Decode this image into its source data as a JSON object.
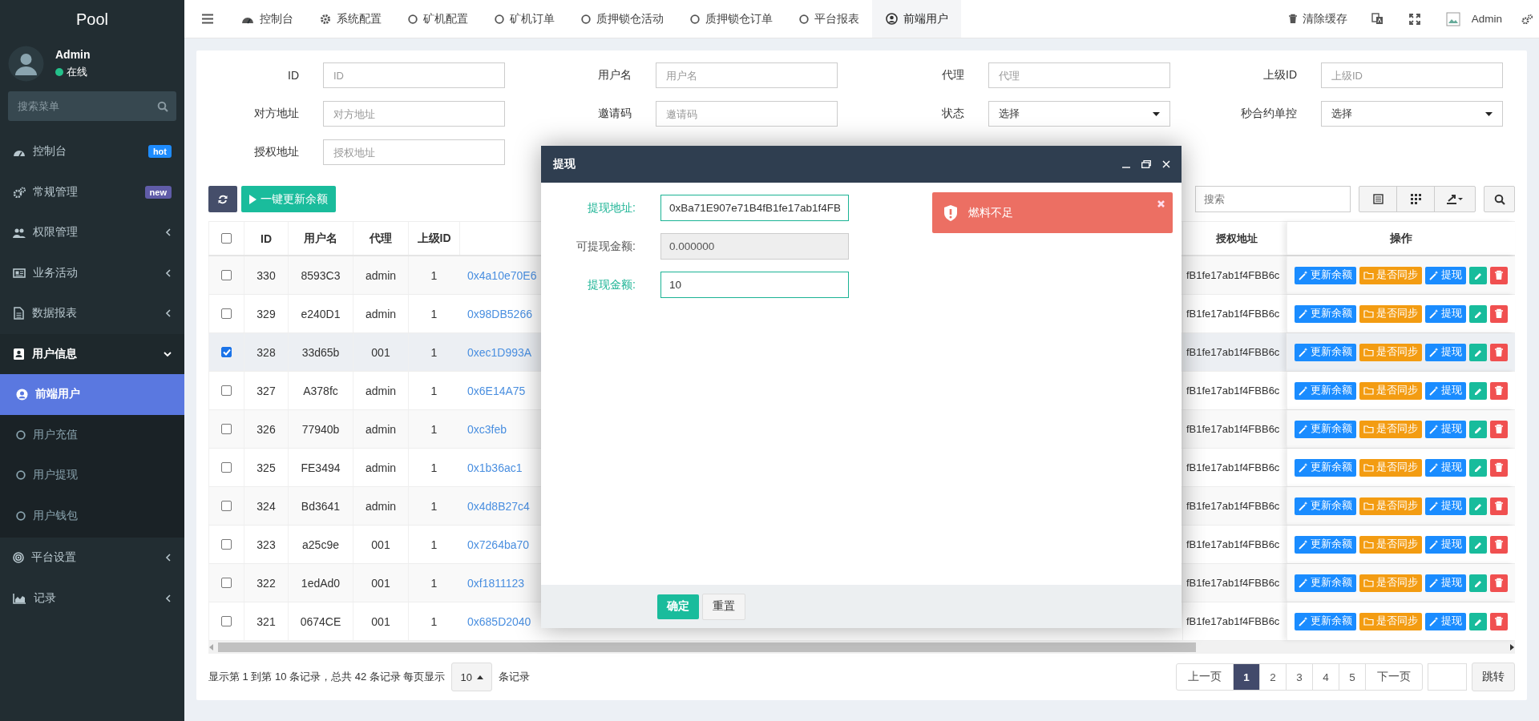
{
  "sidebar": {
    "brand": "Pool",
    "user": {
      "name": "Admin",
      "status": "在线"
    },
    "search": {
      "placeholder": "搜索菜单"
    },
    "items": [
      {
        "label": "控制台",
        "selected": false,
        "badge": {
          "text": "hot",
          "color": "#1e8cff"
        }
      },
      {
        "label": "常规管理",
        "selected": false,
        "badge": {
          "text": "new",
          "color": "#605ca8"
        }
      },
      {
        "label": "权限管理",
        "selected": false,
        "expanded": false
      },
      {
        "label": "业务活动",
        "selected": false,
        "expanded": false
      },
      {
        "label": "数据报表",
        "selected": false,
        "expanded": false
      },
      {
        "label": "用户信息",
        "selected": false,
        "expanded": true,
        "children": [
          {
            "label": "前端用户",
            "selected": true
          },
          {
            "label": "用户充值",
            "selected": false
          },
          {
            "label": "用户提现",
            "selected": false
          },
          {
            "label": "用户钱包",
            "selected": false
          }
        ]
      },
      {
        "label": "平台设置",
        "selected": false,
        "expanded": false
      },
      {
        "label": "记录",
        "selected": false,
        "expanded": false
      }
    ]
  },
  "tabs": [
    {
      "label": "控制台",
      "selected": false
    },
    {
      "label": "系统配置",
      "selected": false
    },
    {
      "label": "矿机配置",
      "selected": false
    },
    {
      "label": "矿机订单",
      "selected": false
    },
    {
      "label": "质押锁仓活动",
      "selected": false
    },
    {
      "label": "质押锁仓订单",
      "selected": false
    },
    {
      "label": "平台报表",
      "selected": false
    },
    {
      "label": "前端用户",
      "selected": true
    }
  ],
  "topbar": {
    "clear_cache": "清除缓存",
    "user": "Admin"
  },
  "filters": [
    {
      "label": "ID",
      "kind": "text",
      "placeholder": "ID"
    },
    {
      "label": "用户名",
      "kind": "text",
      "placeholder": "用户名"
    },
    {
      "label": "代理",
      "kind": "text",
      "placeholder": "代理"
    },
    {
      "label": "上级ID",
      "kind": "text",
      "placeholder": "上级ID"
    },
    {
      "label": "对方地址",
      "kind": "text",
      "placeholder": "对方地址"
    },
    {
      "label": "邀请码",
      "kind": "text",
      "placeholder": "邀请码"
    },
    {
      "label": "状态",
      "kind": "select",
      "value": "选择"
    },
    {
      "label": "秒合约单控",
      "kind": "select",
      "value": "选择"
    },
    {
      "label": "授权地址",
      "kind": "text",
      "placeholder": "授权地址"
    }
  ],
  "toolbar": {
    "update_button": "一键更新余额",
    "search": {
      "placeholder": "搜索"
    }
  },
  "table": {
    "all_checked": false,
    "columns": [
      "ID",
      "用户名",
      "代理",
      "上级ID",
      "授权地址",
      "操作"
    ],
    "rows": [
      {
        "checked": false,
        "id": "330",
        "username": "8593C3",
        "agent": "admin",
        "parent_id": "1",
        "column_6": "0x4a10e70E6",
        "auth_address": "fB1fe17ab1f4FBB6c",
        "actions": [
          "更新余额",
          "是否同步",
          "提现"
        ]
      },
      {
        "checked": false,
        "id": "329",
        "username": "e240D1",
        "agent": "admin",
        "parent_id": "1",
        "column_6": "0x98DB5266",
        "auth_address": "fB1fe17ab1f4FBB6c",
        "actions": [
          "更新余额",
          "是否同步",
          "提现"
        ]
      },
      {
        "checked": true,
        "id": "328",
        "username": "33d65b",
        "agent": "001",
        "parent_id": "1",
        "column_6": "0xec1D993A",
        "auth_address": "fB1fe17ab1f4FBB6c",
        "actions": [
          "更新余额",
          "是否同步",
          "提现"
        ]
      },
      {
        "checked": false,
        "id": "327",
        "username": "A378fc",
        "agent": "admin",
        "parent_id": "1",
        "column_6": "0x6E14A75",
        "auth_address": "fB1fe17ab1f4FBB6c",
        "actions": [
          "更新余额",
          "是否同步",
          "提现"
        ]
      },
      {
        "checked": false,
        "id": "326",
        "username": "77940b",
        "agent": "admin",
        "parent_id": "1",
        "column_6": "0xc3feb",
        "auth_address": "fB1fe17ab1f4FBB6c",
        "actions": [
          "更新余额",
          "是否同步",
          "提现"
        ]
      },
      {
        "checked": false,
        "id": "325",
        "username": "FE3494",
        "agent": "admin",
        "parent_id": "1",
        "column_6": "0x1b36ac1",
        "auth_address": "fB1fe17ab1f4FBB6c",
        "actions": [
          "更新余额",
          "是否同步",
          "提现"
        ]
      },
      {
        "checked": false,
        "id": "324",
        "username": "Bd3641",
        "agent": "admin",
        "parent_id": "1",
        "column_6": "0x4d8B27c4",
        "auth_address": "fB1fe17ab1f4FBB6c",
        "actions": [
          "更新余额",
          "是否同步",
          "提现"
        ]
      },
      {
        "checked": false,
        "id": "323",
        "username": "a25c9e",
        "agent": "001",
        "parent_id": "1",
        "column_6": "0x7264ba70",
        "auth_address": "fB1fe17ab1f4FBB6c",
        "actions": [
          "更新余额",
          "是否同步",
          "提现"
        ]
      },
      {
        "checked": false,
        "id": "322",
        "username": "1edAd0",
        "agent": "001",
        "parent_id": "1",
        "column_6": "0xf1811123",
        "auth_address": "fB1fe17ab1f4FBB6c",
        "actions": [
          "更新余额",
          "是否同步",
          "提现"
        ]
      },
      {
        "checked": false,
        "id": "321",
        "username": "0674CE",
        "agent": "001",
        "parent_id": "1",
        "column_6": "0x685D2040",
        "auth_address": "fB1fe17ab1f4FBB6c",
        "actions": [
          "更新余额",
          "是否同步",
          "提现"
        ]
      }
    ]
  },
  "pagination": {
    "summary": "显示第 1 到第 10 条记录，总共 42 条记录 每页显示",
    "page_size": "10",
    "suffix": "条记录",
    "prev": "上一页",
    "pages": [
      {
        "label": "1",
        "selected": true
      },
      {
        "label": "2",
        "selected": false
      },
      {
        "label": "3",
        "selected": false
      },
      {
        "label": "4",
        "selected": false
      },
      {
        "label": "5",
        "selected": false
      }
    ],
    "next": "下一页",
    "jump": "跳转"
  },
  "modal": {
    "title": "提现",
    "fields": [
      {
        "label": "提现地址:",
        "value": "0xBa71E907e71B4fB1fe17ab1f4FB",
        "highlighted": true,
        "disabled": false
      },
      {
        "label": "可提现金额:",
        "value": "0.000000",
        "highlighted": false,
        "disabled": true
      },
      {
        "label": "提现金额:",
        "value": "10",
        "highlighted": true,
        "disabled": false
      }
    ],
    "alert": {
      "text": "燃料不足"
    },
    "buttons": [
      {
        "label": "确定",
        "kind": "primary"
      },
      {
        "label": "重置",
        "kind": "default"
      }
    ]
  }
}
